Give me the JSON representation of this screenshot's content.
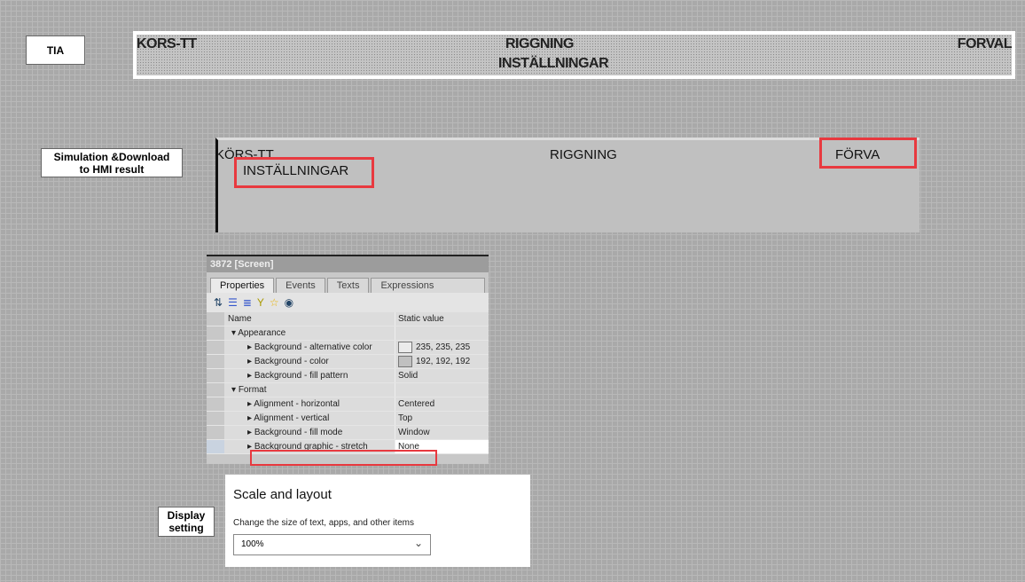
{
  "labels": {
    "tia": "TIA",
    "sim": "Simulation &Download to HMI result",
    "display": "Display setting"
  },
  "tia_header": {
    "left": "KORS-TT",
    "center": "RIGGNING",
    "right": "FORVAL",
    "sub": "INSTÄLLNINGAR"
  },
  "sim_header": {
    "left": "KÖRS-TT",
    "center": "RIGGNING",
    "right": "FÖRVA",
    "sub": "INSTÄLLNINGAR"
  },
  "panel": {
    "title": "3872 [Screen]",
    "tabs": [
      "Properties",
      "Events",
      "Texts",
      "Expressions"
    ],
    "columns": [
      "Name",
      "Static value"
    ],
    "rows": [
      {
        "name": "Appearance",
        "value": "",
        "group": true
      },
      {
        "name": "Background - alternative color",
        "value": "235, 235, 235",
        "swatch": "#ebebeb"
      },
      {
        "name": "Background - color",
        "value": "192, 192, 192",
        "swatch": "#c0c0c0"
      },
      {
        "name": "Background - fill pattern",
        "value": "Solid"
      },
      {
        "name": "Format",
        "value": "",
        "group": true
      },
      {
        "name": "Alignment - horizontal",
        "value": "Centered"
      },
      {
        "name": "Alignment - vertical",
        "value": "Top"
      },
      {
        "name": "Background - fill mode",
        "value": "Window"
      },
      {
        "name": "Background graphic - stretch",
        "value": "None",
        "selected": true
      }
    ]
  },
  "display": {
    "title": "Scale and layout",
    "desc": "Change the size of text, apps, and other items",
    "value": "100%"
  }
}
